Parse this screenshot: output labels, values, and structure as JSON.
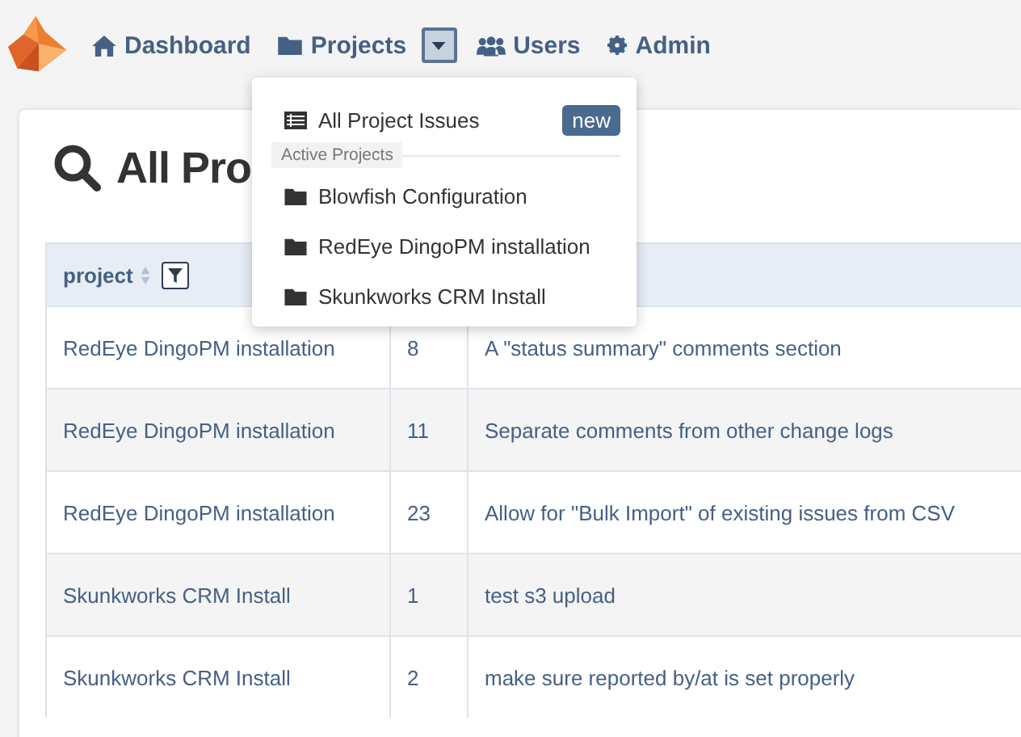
{
  "nav": {
    "items": [
      {
        "label": "Dashboard"
      },
      {
        "label": "Projects"
      },
      {
        "label": "Users"
      },
      {
        "label": "Admin"
      }
    ],
    "dropdown_toggle": {
      "expanded": true
    }
  },
  "dropdown": {
    "top_item": {
      "label": "All Project Issues",
      "badge": "new"
    },
    "section_header": "Active Projects",
    "projects": [
      "Blowfish Configuration",
      "RedEye DingoPM installation",
      "Skunkworks CRM Install"
    ]
  },
  "page": {
    "heading": "All Pro"
  },
  "table": {
    "columns": [
      {
        "label": "project"
      }
    ],
    "rows": [
      {
        "project": "RedEye DingoPM installation",
        "number": "8",
        "summary": "A \"status summary\" comments section"
      },
      {
        "project": "RedEye DingoPM installation",
        "number": "11",
        "summary": "Separate comments from other change logs"
      },
      {
        "project": "RedEye DingoPM installation",
        "number": "23",
        "summary": "Allow for \"Bulk Import\" of existing issues from CSV"
      },
      {
        "project": "Skunkworks CRM Install",
        "number": "1",
        "summary": "test s3 upload"
      },
      {
        "project": "Skunkworks CRM Install",
        "number": "2",
        "summary": "make sure reported by/at is set properly"
      }
    ]
  }
}
